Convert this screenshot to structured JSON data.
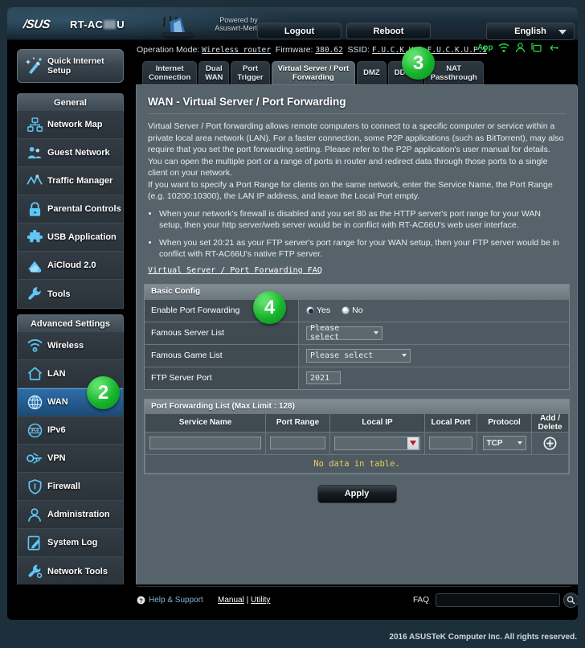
{
  "header": {
    "brand": "/SUS",
    "model_prefix": "RT-AC",
    "model_suffix": "U",
    "powered_by_line1": "Powered by",
    "powered_by_line2": "Asuswrt-Merlin",
    "logout_label": "Logout",
    "reboot_label": "Reboot",
    "language": "English"
  },
  "infobar": {
    "operation_mode_label": "Operation Mode:",
    "operation_mode_value": "Wireless router",
    "firmware_label": "Firmware:",
    "firmware_value": "380.62",
    "ssid_label": "SSID:",
    "ssid_value_1": "F.U.C.K.U.P",
    "ssid_value_2": "F.U.C.K.U.P.5",
    "app_label": "App",
    "icons": [
      "wifi-icon",
      "guest-user-icon",
      "usb-device-icon",
      "usb-icon"
    ]
  },
  "sidebar": {
    "quick_setup_label_line1": "Quick Internet",
    "quick_setup_label_line2": "Setup",
    "groups": [
      {
        "title": "General",
        "items": [
          {
            "label": "Network Map",
            "icon": "network-map-icon",
            "active": false
          },
          {
            "label": "Guest Network",
            "icon": "guest-network-icon",
            "active": false
          },
          {
            "label": "Traffic Manager",
            "icon": "traffic-manager-icon",
            "active": false
          },
          {
            "label": "Parental Controls",
            "icon": "lock-icon",
            "active": false
          },
          {
            "label": "USB Application",
            "icon": "puzzle-icon",
            "active": false
          },
          {
            "label": "AiCloud 2.0",
            "icon": "cloud-icon",
            "active": false
          },
          {
            "label": "Tools",
            "icon": "wrench-icon",
            "active": false
          }
        ]
      },
      {
        "title": "Advanced Settings",
        "items": [
          {
            "label": "Wireless",
            "icon": "wifi-icon",
            "active": false
          },
          {
            "label": "LAN",
            "icon": "house-icon",
            "active": false
          },
          {
            "label": "WAN",
            "icon": "globe-icon",
            "active": true
          },
          {
            "label": "IPv6",
            "icon": "ipv6-globe-icon",
            "active": false
          },
          {
            "label": "VPN",
            "icon": "vpn-key-icon",
            "active": false
          },
          {
            "label": "Firewall",
            "icon": "shield-icon",
            "active": false
          },
          {
            "label": "Administration",
            "icon": "user-icon",
            "active": false
          },
          {
            "label": "System Log",
            "icon": "log-pencil-icon",
            "active": false
          },
          {
            "label": "Network Tools",
            "icon": "network-wrench-icon",
            "active": false
          }
        ]
      }
    ]
  },
  "tabs": [
    {
      "label_line1": "Internet",
      "label_line2": "Connection",
      "active": false
    },
    {
      "label_line1": "Dual",
      "label_line2": "WAN",
      "active": false
    },
    {
      "label_line1": "Port",
      "label_line2": "Trigger",
      "active": false
    },
    {
      "label_line1": "Virtual Server / Port",
      "label_line2": "Forwarding",
      "active": true
    },
    {
      "label_line1": "DMZ",
      "label_line2": "",
      "active": false
    },
    {
      "label_line1": "DDNS",
      "label_line2": "",
      "active": false
    },
    {
      "label_line1": "NAT",
      "label_line2": "Passthrough",
      "active": false
    }
  ],
  "main": {
    "title": "WAN - Virtual Server / Port Forwarding",
    "description_p1": "Virtual Server / Port forwarding allows remote computers to connect to a specific computer or service within a private local area network (LAN). For a faster connection, some P2P applications (such as BitTorrent), may also require that you set the port forwarding setting. Please refer to the P2P application's user manual for details. You can open the multiple port or a range of ports in router and redirect data through those ports to a single client on your network.",
    "description_p2": "If you want to specify a Port Range for clients on the same network, enter the Service Name, the Port Range (e.g. 10200:10300), the LAN IP address, and leave the Local Port empty.",
    "bullets": [
      "When your network's firewall is disabled and you set 80 as the HTTP server's port range for your WAN setup, then your http server/web server would be in conflict with RT-AC66U's web user interface.",
      "When you set 20:21 as your FTP server's port range for your WAN setup, then your FTP server would be in conflict with RT-AC66U's native FTP server."
    ],
    "faq_link": "Virtual Server / Port Forwarding FAQ"
  },
  "basic_config": {
    "section_title": "Basic Config",
    "rows": [
      {
        "label": "Enable Port Forwarding",
        "type": "radio",
        "options": [
          "Yes",
          "No"
        ],
        "selected": "Yes"
      },
      {
        "label": "Famous Server List",
        "type": "select",
        "value": "Please select"
      },
      {
        "label": "Famous Game List",
        "type": "select",
        "value": "Please select"
      },
      {
        "label": "FTP Server Port",
        "type": "text",
        "value": "2021"
      }
    ]
  },
  "port_forwarding_list": {
    "section_title": "Port Forwarding List (Max Limit : 128)",
    "columns": [
      "Service Name",
      "Port Range",
      "Local IP",
      "Local Port",
      "Protocol",
      "Add / Delete"
    ],
    "new_row": {
      "service_name": "",
      "port_range": "",
      "local_ip": "",
      "local_port": "",
      "protocol": "TCP",
      "add_icon": "plus-circle-icon"
    },
    "empty_message": "No data in table.",
    "apply_label": "Apply"
  },
  "footer": {
    "help_label": "Help & Support",
    "manual_label": "Manual",
    "separator": "|",
    "utility_label": "Utility",
    "faq_label": "FAQ",
    "faq_value": "",
    "copyright": "2016 ASUSTeK Computer Inc. All rights reserved."
  },
  "annotations": [
    {
      "number": "2",
      "target": "sidebar-item-wan"
    },
    {
      "number": "3",
      "target": "tab-virtual-server-port-forwarding"
    },
    {
      "number": "4",
      "target": "enable-port-forwarding-row"
    }
  ],
  "colors": {
    "accent_green": "#16b42c",
    "panel_bg": "#57636a",
    "sidebar_active": "#2f6ea8",
    "icon_blue": "#5fc6f5",
    "warning_yellow": "#e8cc62"
  }
}
